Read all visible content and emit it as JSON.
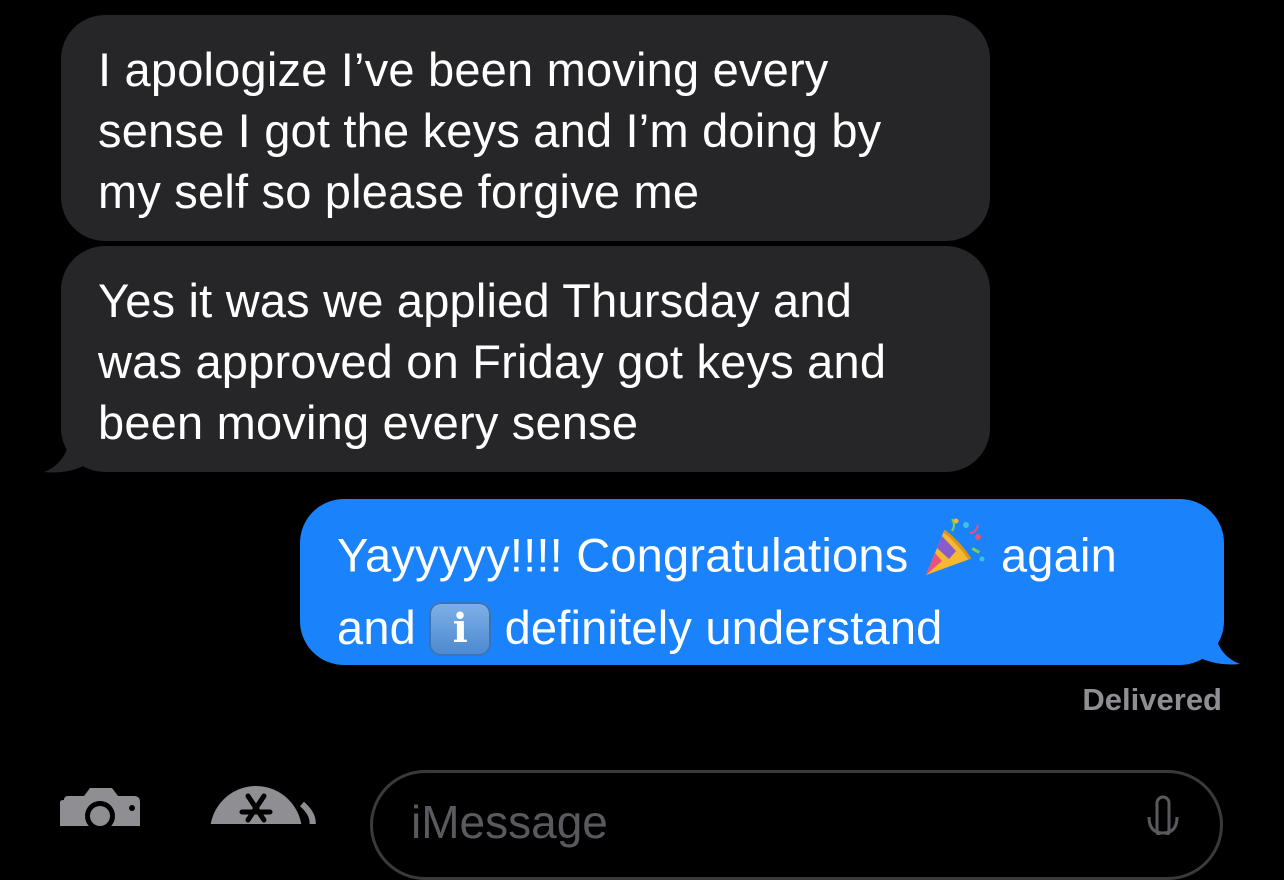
{
  "messages": [
    {
      "direction": "incoming",
      "lines": [
        "I apologize I’ve been moving every",
        "sense I got the keys and I’m doing by",
        "my self so please forgive me"
      ]
    },
    {
      "direction": "incoming",
      "lines": [
        "Yes it was we applied Thursday and",
        "was approved on Friday got keys and",
        "been moving every sense"
      ]
    },
    {
      "direction": "outgoing",
      "line1_before_emoji": "Yayyyyy!!!! Congratulations",
      "line1_emoji": "party-popper-emoji",
      "line1_after_emoji": "again",
      "line2_before_emoji": "and",
      "line2_emoji_char": "i",
      "line2_after_emoji": "definitely understand"
    }
  ],
  "status": "Delivered",
  "composer": {
    "placeholder": "iMessage"
  },
  "toolbar": {
    "left_icons": [
      "camera-icon",
      "app-store-icon"
    ],
    "right_icon": "microphone-icon"
  },
  "colors": {
    "background": "#000000",
    "incoming_bubble": "#262629",
    "outgoing_bubble": "#1a82fb",
    "status_text": "#8e8e93"
  }
}
